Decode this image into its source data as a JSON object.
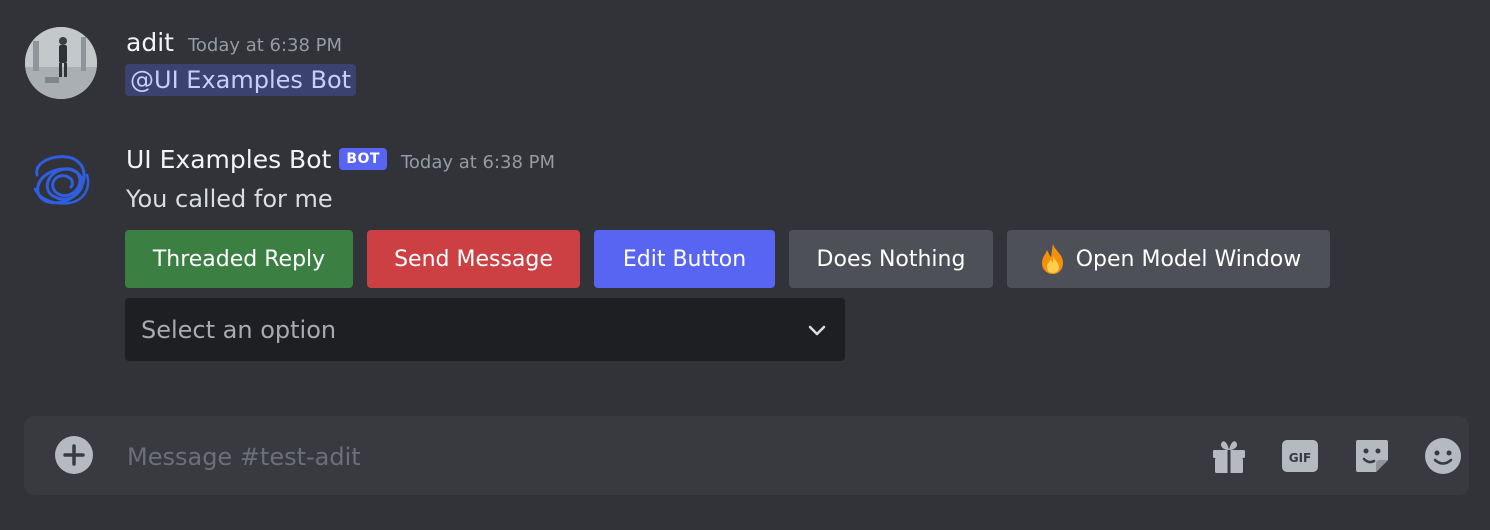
{
  "messages": [
    {
      "username": "adit",
      "timestamp": "Today at 6:38 PM",
      "mention": "@UI Examples Bot"
    },
    {
      "username": "UI Examples Bot",
      "bot_tag": "BOT",
      "timestamp": "Today at 6:38 PM",
      "content": "You called for me",
      "buttons": [
        {
          "label": "Threaded Reply",
          "style": "success",
          "color": "#3b8042"
        },
        {
          "label": "Send Message",
          "style": "danger",
          "color": "#cc4044"
        },
        {
          "label": "Edit Button",
          "style": "primary",
          "color": "#5865f2"
        },
        {
          "label": "Does Nothing",
          "style": "secondary",
          "color": "#4e5058"
        },
        {
          "label": "Open Model Window",
          "style": "secondary",
          "color": "#4e5058",
          "emoji": "fire-icon"
        }
      ],
      "select": {
        "placeholder": "Select an option"
      }
    }
  ],
  "composer": {
    "placeholder": "Message #test-adit",
    "icons": [
      "add-icon",
      "gift-icon",
      "gif-icon",
      "sticker-icon",
      "emoji-icon"
    ]
  },
  "colors": {
    "background": "#313338",
    "composer": "#383a40",
    "select": "#1e1f22",
    "mention_bg": "#3c4270",
    "mention_text": "#c9cdfb",
    "bot_tag": "#5865f2"
  }
}
